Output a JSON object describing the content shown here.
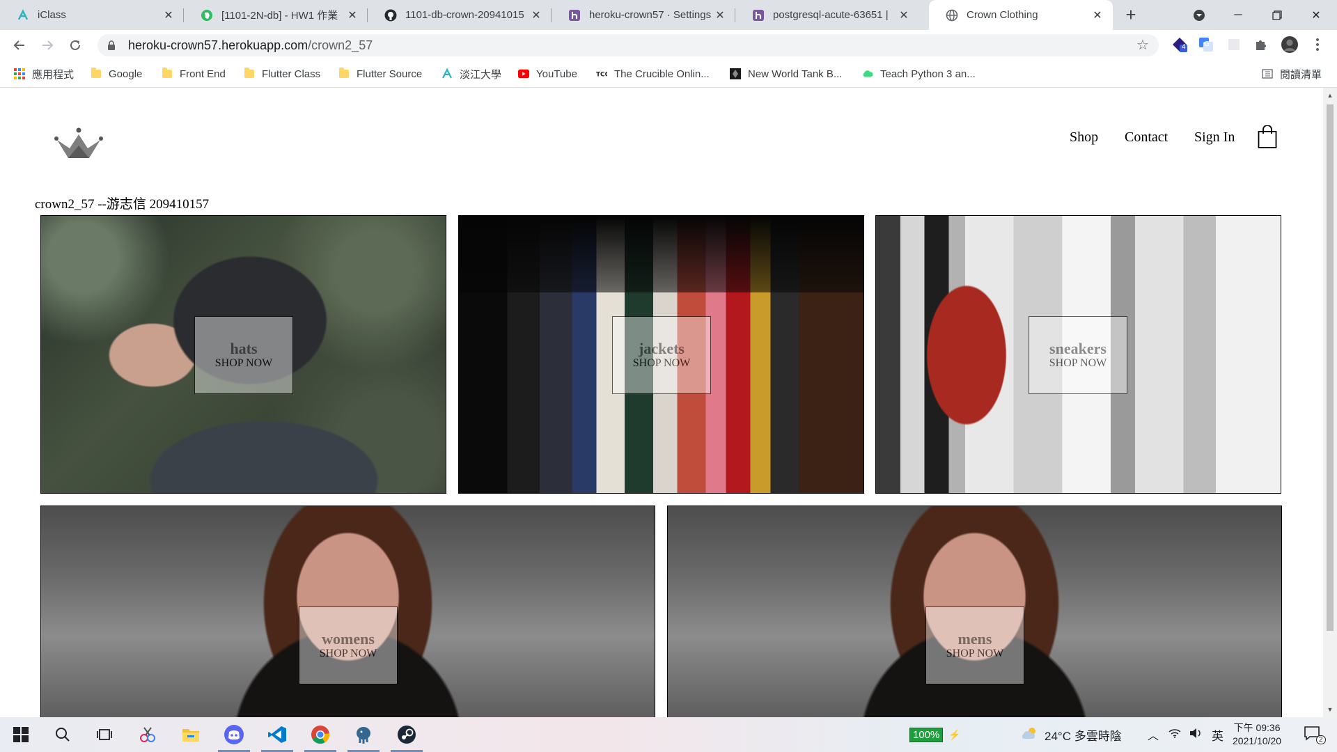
{
  "browser": {
    "tabs": [
      {
        "title": "iClass",
        "icon": "iclass-icon",
        "active": false
      },
      {
        "title": "[1101-2N-db] - HW1 作業",
        "icon": "evernote-icon",
        "active": false
      },
      {
        "title": "1101-db-crown-20941015",
        "icon": "github-icon",
        "active": false
      },
      {
        "title": "heroku-crown57 · Settings",
        "icon": "heroku-icon",
        "active": false
      },
      {
        "title": "postgresql-acute-63651 | ",
        "icon": "heroku-icon",
        "active": false
      },
      {
        "title": "Crown Clothing",
        "icon": "globe-icon",
        "active": true
      }
    ],
    "address": {
      "host": "heroku-crown57.herokuapp.com",
      "path": "/crown2_57"
    },
    "extension_badge": "4",
    "bookmarks": [
      {
        "label": "應用程式",
        "icon": "apps-grid-icon"
      },
      {
        "label": "Google",
        "icon": "folder-icon"
      },
      {
        "label": "Front End",
        "icon": "folder-icon"
      },
      {
        "label": "Flutter Class",
        "icon": "folder-icon"
      },
      {
        "label": "Flutter Source",
        "icon": "folder-icon"
      },
      {
        "label": "淡江大學",
        "icon": "iclass-icon"
      },
      {
        "label": "YouTube",
        "icon": "youtube-icon"
      },
      {
        "label": "The Crucible Onlin...",
        "icon": "tco-icon"
      },
      {
        "label": "New World Tank B...",
        "icon": "newworld-icon"
      },
      {
        "label": "Teach Python 3 an...",
        "icon": "cloud-icon"
      }
    ],
    "reading_list": "閱讀清單"
  },
  "page": {
    "nav": {
      "shop": "Shop",
      "contact": "Contact",
      "sign_in": "Sign In"
    },
    "heading": "crown2_57 --游志信 209410157",
    "categories": [
      {
        "title": "hats",
        "subtitle": "SHOP NOW"
      },
      {
        "title": "jackets",
        "subtitle": "SHOP NOW"
      },
      {
        "title": "sneakers",
        "subtitle": "SHOP NOW"
      },
      {
        "title": "womens",
        "subtitle": "SHOP NOW"
      },
      {
        "title": "mens",
        "subtitle": "SHOP NOW"
      }
    ]
  },
  "taskbar": {
    "battery": "100%",
    "weather": "24°C 多雲時陰",
    "ime": "英",
    "time": "下午 09:36",
    "date": "2021/10/20",
    "notification_count": "2"
  },
  "colors": {
    "tab_strip": "#dee1e6",
    "taskbar_accent": "#6b8fc4",
    "battery_green": "#1e9e3c"
  }
}
